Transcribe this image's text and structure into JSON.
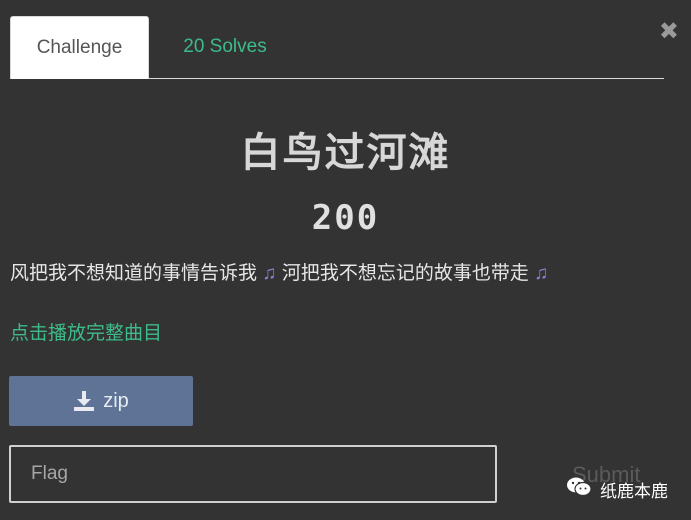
{
  "tabs": {
    "active": "Challenge",
    "inactive": "20 Solves"
  },
  "challenge": {
    "title": "白鸟过河滩",
    "points": "200",
    "description_part1": "风把我不想知道的事情告诉我",
    "description_part2": "河把我不想忘记的故事也带走",
    "note_glyph": "♫",
    "link_text": "点击播放完整曲目"
  },
  "download": {
    "label": "zip"
  },
  "flag_input": {
    "placeholder": "Flag",
    "value": ""
  },
  "submit": {
    "label": "Submit"
  },
  "watermark": {
    "text": "纸鹿本鹿"
  },
  "colors": {
    "background": "#333333",
    "accent_green": "#3dbb8a",
    "download_button": "#5e7396",
    "note_purple": "#8a7fd6"
  },
  "icons": [
    "close-icon",
    "download-icon",
    "music-note-icon",
    "wechat-icon"
  ]
}
